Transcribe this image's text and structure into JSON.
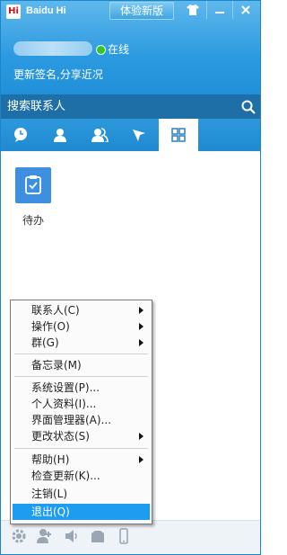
{
  "window": {
    "logo": "Hi",
    "title": "Baidu Hi",
    "trial_button": "体验新版",
    "buttons": {
      "skin": "shirt-icon",
      "minimize": "minimize-icon",
      "close": "close-icon"
    }
  },
  "profile": {
    "status": "在线",
    "signature": "更新签名,分享近况"
  },
  "search": {
    "placeholder": "搜索联系人"
  },
  "tabs": [
    {
      "name": "chat-bubble-icon"
    },
    {
      "name": "contact-icon"
    },
    {
      "name": "group-icon"
    },
    {
      "name": "send-icon"
    },
    {
      "name": "apps-grid-icon"
    }
  ],
  "apps": [
    {
      "label": "待办"
    }
  ],
  "menu": {
    "items": [
      {
        "label": "联系人(C)",
        "submenu": true
      },
      {
        "label": "操作(O)",
        "submenu": true
      },
      {
        "label": "群(G)",
        "submenu": true
      },
      {
        "label": "备忘录(M)"
      },
      {
        "label": "系统设置(P)..."
      },
      {
        "label": "个人资料(I)..."
      },
      {
        "label": "界面管理器(A)..."
      },
      {
        "label": "更改状态(S)",
        "submenu": true
      },
      {
        "label": "帮助(H)",
        "submenu": true
      },
      {
        "label": "检查更新(K)..."
      },
      {
        "label": "注销(L)"
      },
      {
        "label": "退出(Q)",
        "highlighted": true
      }
    ]
  },
  "colors": {
    "header": "#2c9ae0",
    "menu_highlight": "#1e9cf0",
    "online": "#35c42b"
  }
}
